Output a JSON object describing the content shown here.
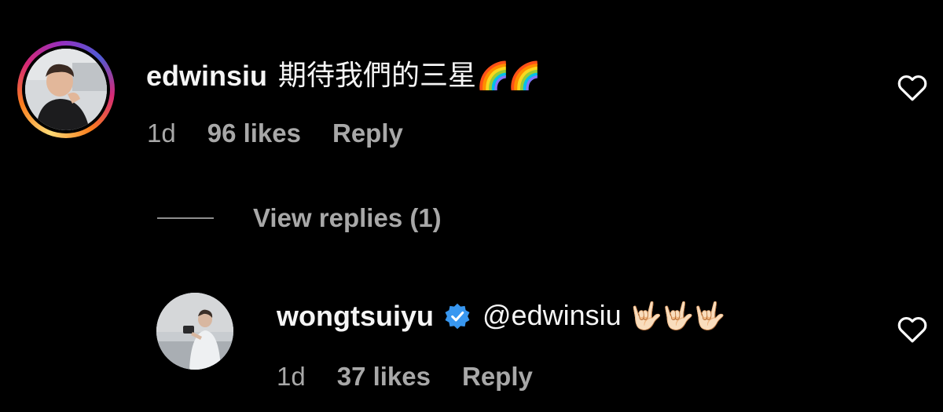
{
  "comments": [
    {
      "username": "edwinsiu",
      "text": "期待我們的三星",
      "emoji": "🌈🌈",
      "time": "1d",
      "likes": "96 likes",
      "reply_label": "Reply",
      "story_ring": true
    },
    {
      "username": "wongtsuiyu",
      "verified": true,
      "text": "@edwinsiu",
      "emoji": "🤟🏻🤟🏻🤟🏻",
      "time": "1d",
      "likes": "37 likes",
      "reply_label": "Reply"
    }
  ],
  "view_replies": {
    "label": "View replies (1)"
  },
  "colors": {
    "background": "#000000",
    "primary_text": "#f5f5f5",
    "secondary_text": "#a8a8a8",
    "verified_blue": "#3897f0"
  },
  "icons": [
    "heart-outline-icon",
    "verified-badge-icon",
    "story-ring"
  ]
}
